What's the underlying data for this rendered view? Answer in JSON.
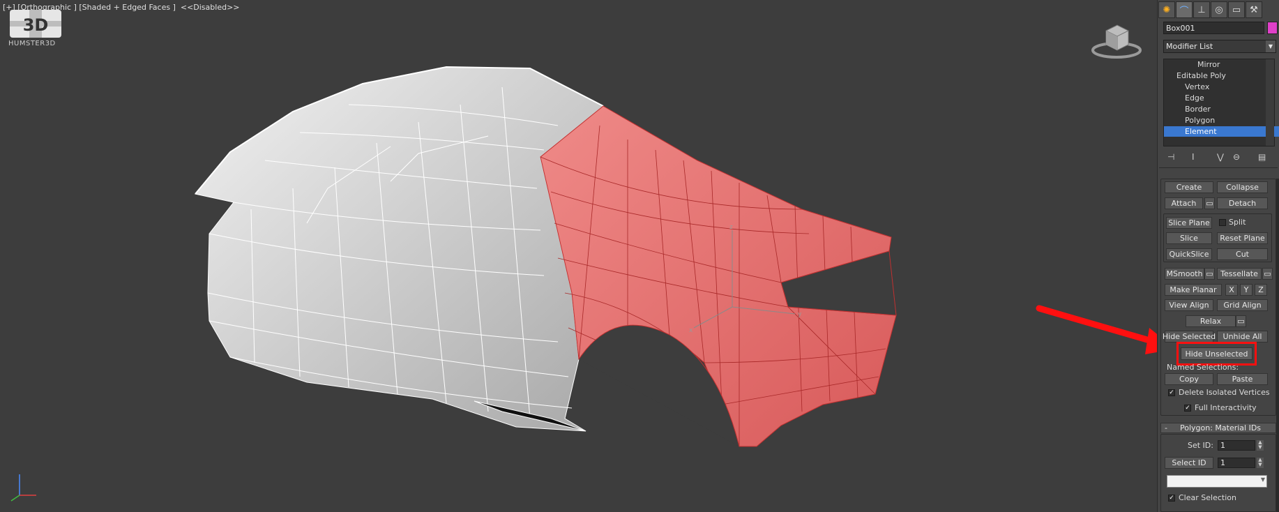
{
  "viewport": {
    "label": "[+] [Orthographic ] [Shaded + Edged Faces ]  <<Disabled>>",
    "logo_text": "HUMSTER3D",
    "logo_mark": "3D",
    "gizmo_axes": [
      "z",
      "y",
      "x"
    ]
  },
  "panel": {
    "tabs": [
      {
        "name": "create-icon",
        "glyph": "✺"
      },
      {
        "name": "modify-icon",
        "glyph": "⌒"
      },
      {
        "name": "hierarchy-icon",
        "glyph": "⊥"
      },
      {
        "name": "motion-icon",
        "glyph": "◎"
      },
      {
        "name": "display-icon",
        "glyph": "▭"
      },
      {
        "name": "utilities-icon",
        "glyph": "⚒"
      }
    ],
    "object_name": "Box001",
    "object_color": "#e040c8",
    "modifier_list_label": "Modifier List",
    "stack": [
      {
        "label": "Mirror",
        "indent": 2
      },
      {
        "label": "Editable Poly",
        "indent": 1
      },
      {
        "label": "Vertex",
        "indent": 2
      },
      {
        "label": "Edge",
        "indent": 2
      },
      {
        "label": "Border",
        "indent": 2
      },
      {
        "label": "Polygon",
        "indent": 2
      },
      {
        "label": "Element",
        "indent": 2,
        "selected": true
      }
    ],
    "edit_geometry": {
      "create": "Create",
      "collapse": "Collapse",
      "attach": "Attach",
      "detach": "Detach",
      "slice_plane": "Slice Plane",
      "split": "Split",
      "slice": "Slice",
      "reset_plane": "Reset Plane",
      "quickslice": "QuickSlice",
      "cut": "Cut",
      "msmooth": "MSmooth",
      "tessellate": "Tessellate",
      "make_planar": "Make Planar",
      "x": "X",
      "y": "Y",
      "z": "Z",
      "view_align": "View Align",
      "grid_align": "Grid Align",
      "relax": "Relax",
      "hide_selected": "Hide Selected",
      "unhide_all": "Unhide All",
      "hide_unselected": "Hide Unselected",
      "named_selections": "Named Selections:",
      "copy": "Copy",
      "paste": "Paste",
      "delete_isolated": "Delete Isolated Vertices",
      "full_interactivity": "Full Interactivity"
    },
    "material_ids": {
      "toggle": "-",
      "title": "Polygon: Material IDs",
      "set_id_label": "Set ID:",
      "set_id_value": "1",
      "select_id": "Select ID",
      "select_id_value": "1",
      "clear_selection": "Clear Selection"
    }
  },
  "colors": {
    "selection": "#e87070",
    "mesh": "#d8d8d8",
    "highlight": "#ff1010"
  }
}
